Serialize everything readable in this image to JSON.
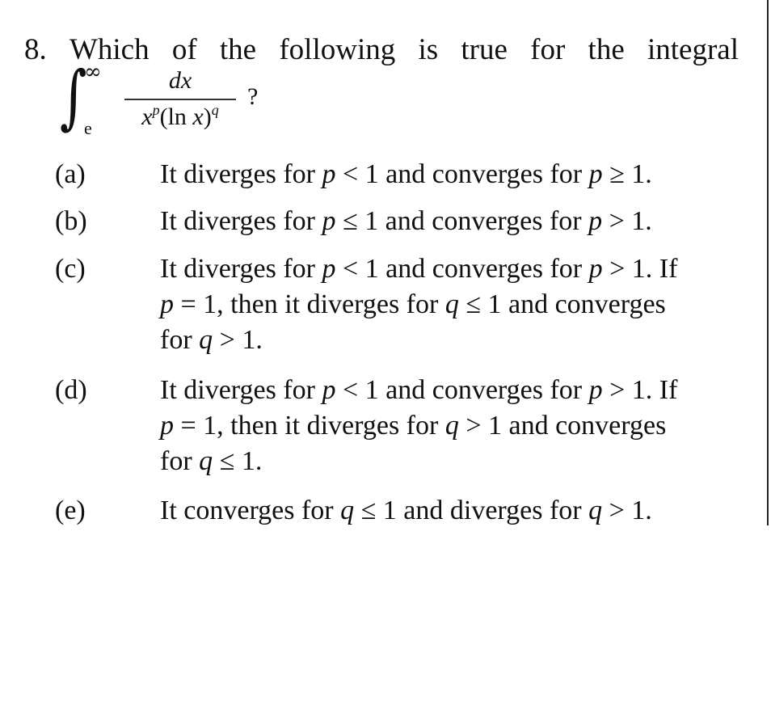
{
  "question": {
    "number": "8.",
    "title_words": [
      "8.",
      "Which",
      "of",
      "the",
      "following",
      "is",
      "true",
      "for",
      "the",
      "integral"
    ],
    "integral": {
      "sign": "∫",
      "upper_limit": "∞",
      "lower_limit": "e",
      "numerator": "dx",
      "denominator": {
        "base": "x",
        "base_exp": "p",
        "log_open": "(ln ",
        "log_var": "x",
        "log_close": ")",
        "log_exp": "q"
      },
      "trailing": "?"
    }
  },
  "options": [
    {
      "label": "(a)",
      "lines": [
        "It diverges for p < 1 and converges for p ≥ 1."
      ]
    },
    {
      "label": "(b)",
      "lines": [
        "It diverges for p ≤ 1 and converges for p > 1."
      ]
    },
    {
      "label": "(c)",
      "lines": [
        "It diverges for p < 1 and converges for p > 1. If",
        "p = 1, then it diverges for q ≤ 1 and converges",
        "for q > 1."
      ]
    },
    {
      "label": "(d)",
      "lines": [
        "It diverges for p < 1 and converges for p > 1. If",
        "p = 1, then it diverges for q > 1 and converges",
        "for q ≤ 1."
      ]
    },
    {
      "label": "(e)",
      "lines": [
        "It converges for q ≤ 1 and diverges for q > 1."
      ]
    }
  ]
}
